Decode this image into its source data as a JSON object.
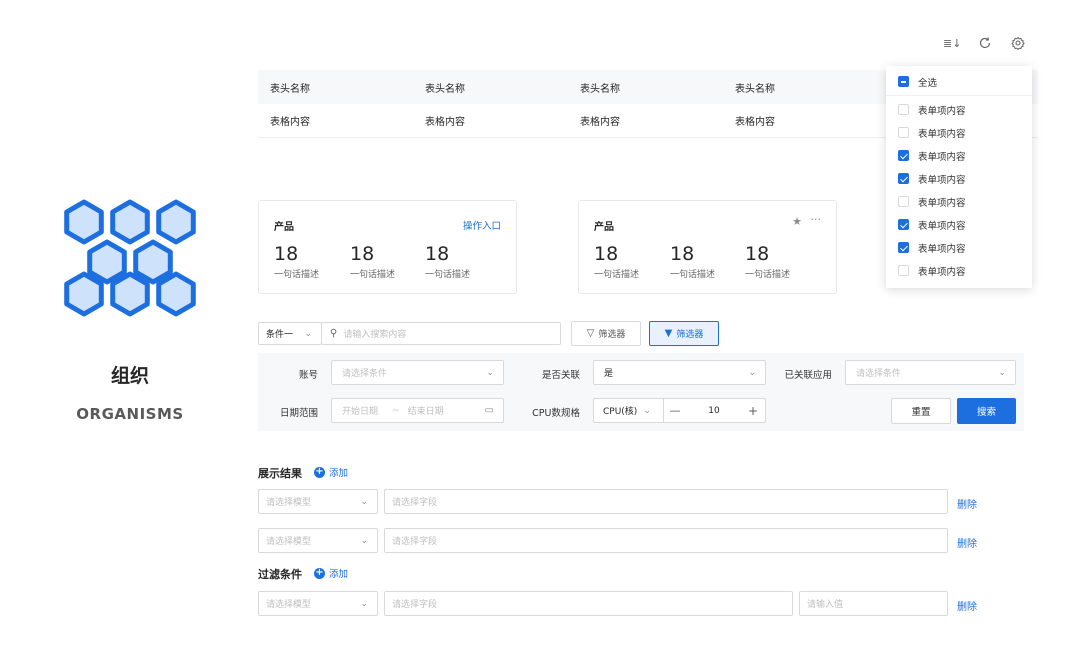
{
  "toolbar": {
    "icons": [
      "column-settings-icon",
      "refresh-icon",
      "settings-icon"
    ],
    "column_glyph": "≣↓"
  },
  "table": {
    "headers": [
      "表头名称",
      "表头名称",
      "表头名称",
      "表头名称"
    ],
    "row": [
      "表格内容",
      "表格内容",
      "表格内容",
      "表格内容"
    ]
  },
  "column_popup": {
    "select_all": "全选",
    "items": [
      {
        "label": "表单项内容",
        "checked": false
      },
      {
        "label": "表单项内容",
        "checked": false
      },
      {
        "label": "表单项内容",
        "checked": true
      },
      {
        "label": "表单项内容",
        "checked": true
      },
      {
        "label": "表单项内容",
        "checked": false
      },
      {
        "label": "表单项内容",
        "checked": true
      },
      {
        "label": "表单项内容",
        "checked": true
      },
      {
        "label": "表单项内容",
        "checked": false
      }
    ]
  },
  "logo": {
    "title": "组织",
    "subtitle": "ORGANISMS",
    "color": "#1d6fe0",
    "fill": "#cfe2fb"
  },
  "cards": [
    {
      "title": "产品",
      "action": "操作入口",
      "stats": [
        {
          "value": "18",
          "desc": "一句话描述"
        },
        {
          "value": "18",
          "desc": "一句话描述"
        },
        {
          "value": "18",
          "desc": "一句话描述"
        }
      ]
    },
    {
      "title": "产品",
      "action_icons": [
        "star-icon",
        "more-icon"
      ],
      "stats": [
        {
          "value": "18",
          "desc": "一句话描述"
        },
        {
          "value": "18",
          "desc": "一句话描述"
        },
        {
          "value": "18",
          "desc": "一句话描述"
        }
      ]
    }
  ],
  "search_bar": {
    "condition": "条件一",
    "search_placeholder": "请输入搜索内容",
    "filter1": "筛选器",
    "filter2": "筛选器"
  },
  "filters": {
    "account_label": "账号",
    "account_placeholder": "请选择条件",
    "related_label": "是否关联",
    "related_value": "是",
    "app_label": "已关联应用",
    "app_placeholder": "请选择条件",
    "date_label": "日期范围",
    "start_placeholder": "开始日期",
    "date_sep": "~",
    "end_placeholder": "结束日期",
    "cpu_label": "CPU数规格",
    "cpu_unit": "CPU(核)",
    "cpu_value": "10",
    "reset": "重置",
    "search": "搜索"
  },
  "results": {
    "title": "展示结果",
    "add": "添加",
    "rows": [
      {
        "model_placeholder": "请选择模型",
        "field_placeholder": "请选择字段",
        "delete": "删除"
      },
      {
        "model_placeholder": "请选择模型",
        "field_placeholder": "请选择字段",
        "delete": "删除"
      }
    ]
  },
  "conditions": {
    "title": "过滤条件",
    "add": "添加",
    "row": {
      "model_placeholder": "请选择模型",
      "field_placeholder": "请选择字段",
      "value_placeholder": "请输入值",
      "delete": "删除"
    }
  },
  "colors": {
    "primary": "#1d6fe0"
  }
}
